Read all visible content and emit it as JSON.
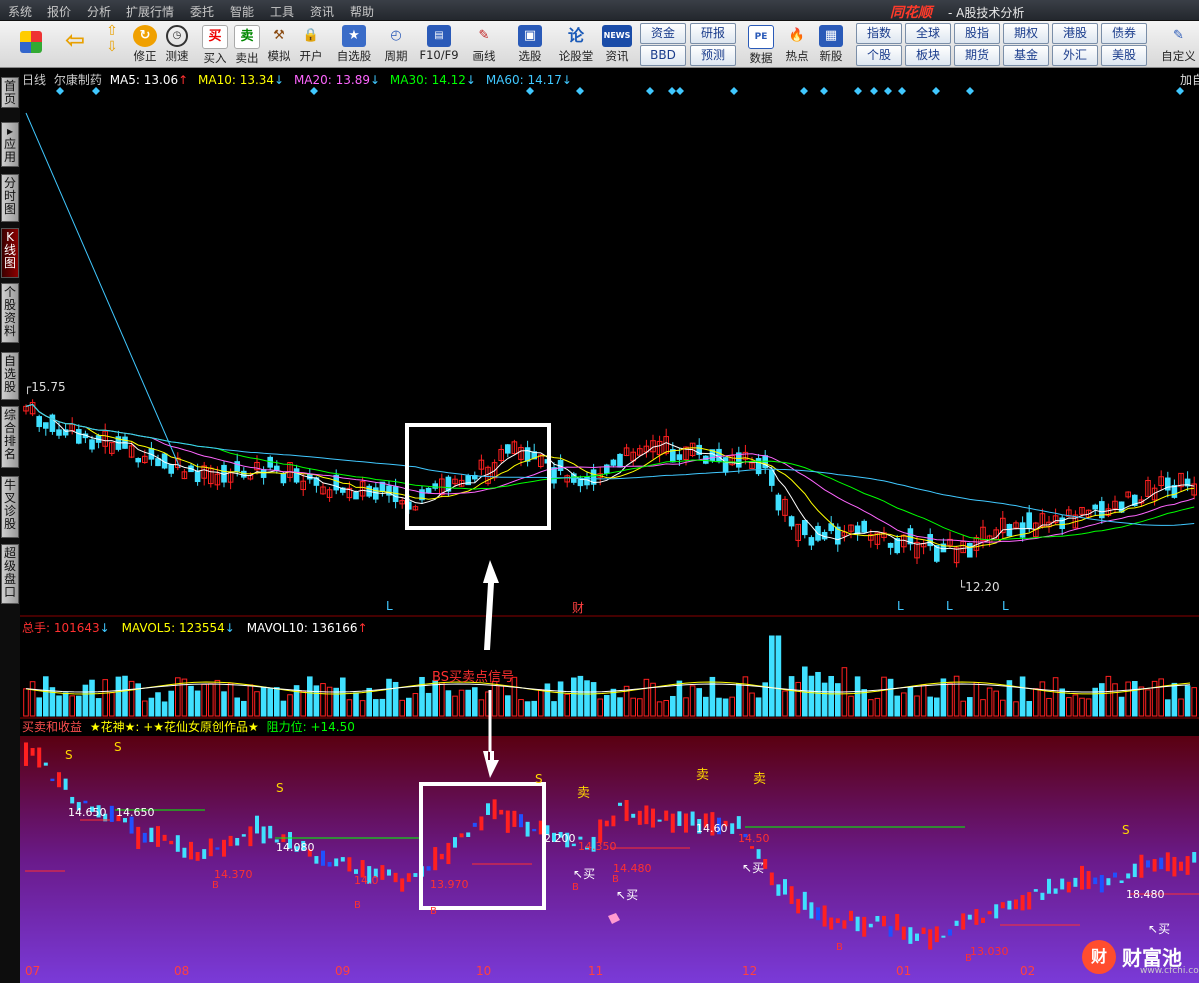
{
  "menu": {
    "items": [
      "系统",
      "报价",
      "分析",
      "扩展行情",
      "委托",
      "智能",
      "工具",
      "资讯",
      "帮助"
    ],
    "logo": "同花顺",
    "title": "- A股技术分析"
  },
  "toolbar": {
    "buttons": [
      "修正",
      "测速",
      "买入",
      "卖出",
      "模拟",
      "开户",
      "自选股",
      "周期",
      "F10/F9",
      "画线",
      "选股",
      "论股堂",
      "资讯",
      "数据",
      "热点",
      "新股",
      "自定义"
    ],
    "small_buttons": [
      "资金",
      "BBD",
      "研报",
      "预测",
      "指数",
      "全球",
      "股指",
      "期权",
      "港股",
      "债券",
      "个股",
      "板块",
      "期货",
      "基金",
      "外汇",
      "美股"
    ],
    "icon_texts": {
      "buy": "买",
      "sell": "卖",
      "news": "NEWS",
      "f10": "PE"
    }
  },
  "left_tabs": [
    "首页",
    "应用",
    "分时图",
    "K线图",
    "个股资料",
    "自选股",
    "综合排名",
    "牛叉诊股",
    "超级盘口"
  ],
  "main_header": {
    "period": "日线",
    "stock": "尔康制药",
    "ma5": "MA5: 13.06",
    "ma10": "MA10: 13.34",
    "ma20": "MA20: 13.89",
    "ma30": "MA30: 14.12",
    "ma60": "MA60: 14.17",
    "right": "加自",
    "arrow_up": "↑",
    "arrow_down": "↓"
  },
  "price_labels": {
    "high": "15.75",
    "low": "12.20"
  },
  "markers": {
    "l": "L",
    "cai": "财"
  },
  "volume_header": {
    "total": "总手: 101643",
    "mavol5": "MAVOL5: 123554",
    "mavol10": "MAVOL10: 136166"
  },
  "indicator_header": {
    "name": "买卖和收益",
    "star1": "★花神★: +★花仙女原创作品★",
    "resist": "阻力位: +14.50"
  },
  "annotation": {
    "text": "BS买卖点信号"
  },
  "indicator_labels": {
    "s": "S",
    "b": "B",
    "sell": "卖",
    "buy": "买",
    "prices": [
      "14.650",
      "14.080",
      "14.370",
      "14.0",
      "13.970",
      "14.480",
      "13.030",
      "18.480",
      "2.200",
      "14.350",
      "14.50",
      "14.60"
    ]
  },
  "x_axis": [
    "07",
    "08",
    "09",
    "10",
    "11",
    "12",
    "01",
    "02"
  ],
  "watermark": {
    "icon": "财",
    "text": "财富池",
    "url": "www.cfchi.com"
  },
  "colors": {
    "up": "#ff2020",
    "down": "#40e0ff",
    "ma5": "#ffffff",
    "ma10": "#ffff00",
    "ma20": "#ff66ff",
    "ma30": "#00ff00",
    "ma60": "#40c8ff",
    "box": "#ffffff"
  }
}
